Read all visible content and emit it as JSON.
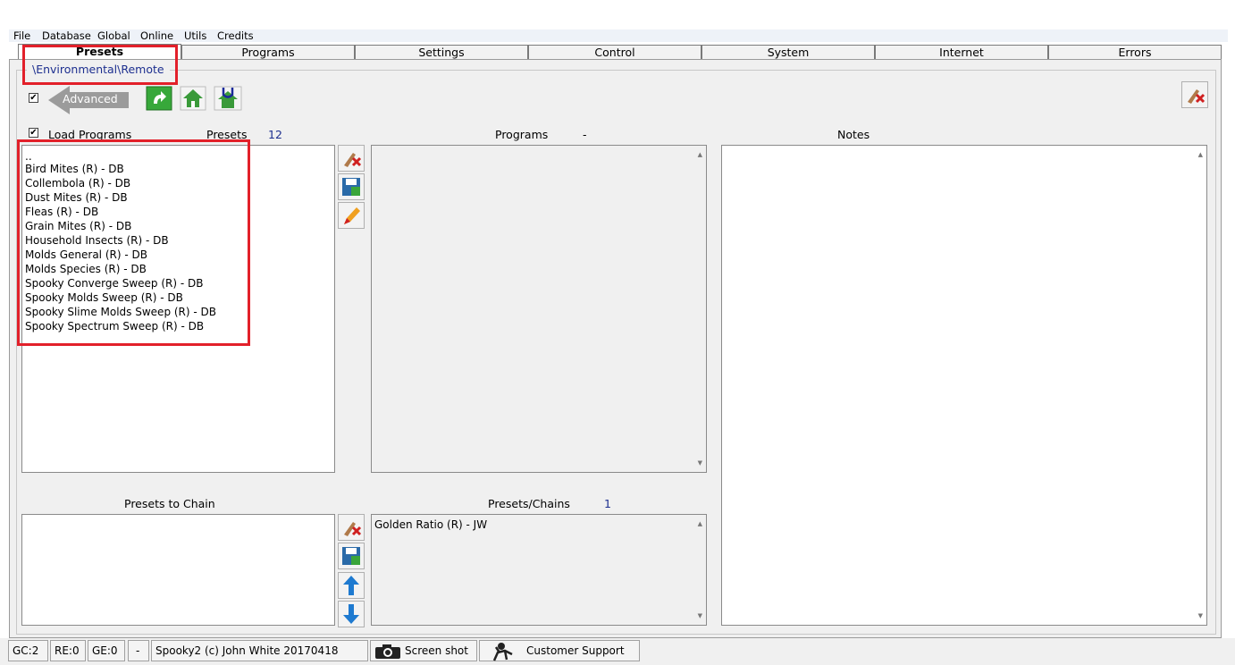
{
  "menu": [
    "File",
    "Database",
    "Global",
    "Online",
    "Utils",
    "Credits"
  ],
  "tabs": [
    "Presets",
    "Programs",
    "Settings",
    "Control",
    "System",
    "Internet",
    "Errors"
  ],
  "active_tab": "Presets",
  "path": "\\Environmental\\Remote",
  "advanced_label": "Advanced",
  "load_programs_label": "Load Programs",
  "presets_header": "Presets",
  "presets_count": "12",
  "programs_header": "Programs",
  "programs_count": "-",
  "notes_header": "Notes",
  "presets_list": [
    "..",
    "Bird Mites (R) - DB",
    "Collembola (R) - DB",
    "Dust Mites (R) - DB",
    "Fleas (R) - DB",
    "Grain Mites (R) - DB",
    "Household Insects (R) - DB",
    "Molds General (R) - DB",
    "Molds Species (R) - DB",
    "Spooky Converge Sweep (R) - DB",
    "Spooky Molds Sweep (R) - DB",
    "Spooky Slime Molds Sweep (R) - DB",
    "Spooky Spectrum Sweep (R) - DB"
  ],
  "presets_to_chain_header": "Presets to Chain",
  "presets_chains_header": "Presets/Chains",
  "presets_chains_count": "1",
  "presets_chains_list": [
    "Golden Ratio (R) - JW"
  ],
  "status": {
    "gc": "GC:2",
    "re": "RE:0",
    "ge": "GE:0",
    "dash": "-",
    "copyright": "Spooky2 (c) John White 20170418",
    "screenshot": "Screen shot",
    "support": "Customer Support"
  },
  "colors": {
    "highlight": "#e2202a",
    "accent_green": "#3aa53a",
    "count_blue": "#1d2f8f"
  }
}
